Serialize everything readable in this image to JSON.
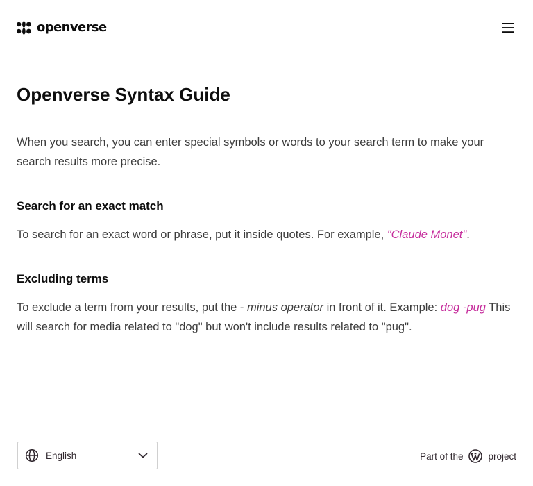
{
  "header": {
    "logo_text": "openverse",
    "logo_icon": "openverse-logo-icon",
    "menu_icon": "menu-icon"
  },
  "main": {
    "title": "Openverse Syntax Guide",
    "intro": "When you search, you can enter special symbols or words to your search term to make your search results more precise.",
    "exact_match": {
      "heading": "Search for an exact match",
      "text_before": "To search for an exact word or phrase, put it inside quotes. For example, ",
      "example": "\"Claude Monet\"",
      "text_after": "."
    },
    "excluding": {
      "heading": "Excluding terms",
      "text_before": "To exclude a term from your results, put the - ",
      "operator": "minus operator",
      "text_middle": " in front of it. Example: ",
      "example": "dog -pug",
      "text_after": " This will search for media related to \"dog\" but won't include results related to \"pug\"."
    }
  },
  "footer": {
    "language_selected": "English",
    "globe_icon": "globe-icon",
    "chevron_icon": "chevron-down-icon",
    "credit_before": "Part of the",
    "credit_icon": "wordpress-icon",
    "credit_after": "project"
  },
  "colors": {
    "accent_pink": "#c52b9b",
    "heading": "#0d0d0d",
    "body_text": "#3c3c3c",
    "border": "#e1e1e1"
  }
}
